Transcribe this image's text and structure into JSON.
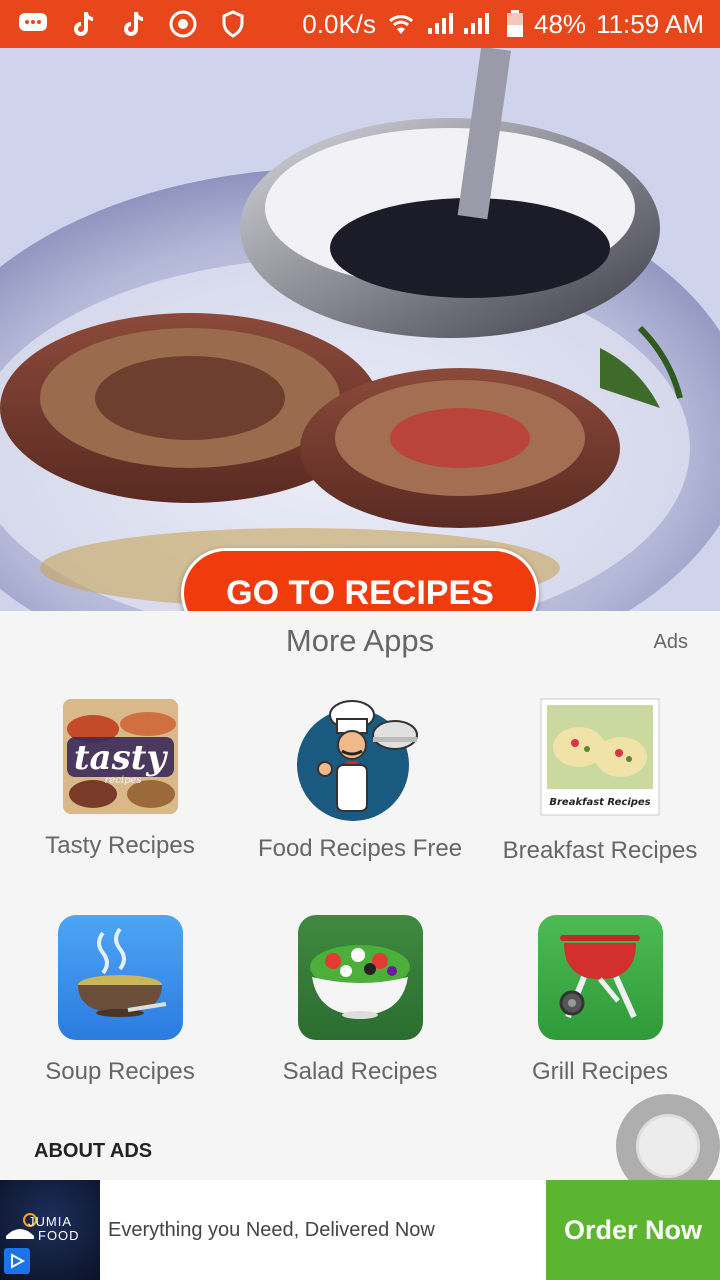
{
  "status_bar": {
    "network_speed": "0.0K/s",
    "battery": "48%",
    "time": "11:59 AM"
  },
  "hero": {
    "cta_label": "GO TO RECIPES"
  },
  "more_apps": {
    "title": "More Apps",
    "ads_label": "Ads",
    "apps": [
      {
        "label": "Tasty Recipes",
        "icon_text": "tasty",
        "icon_subtext": "recipes"
      },
      {
        "label": "Food Recipes Free"
      },
      {
        "label": "Breakfast Recipes",
        "icon_text": "Breakfast Recipes"
      },
      {
        "label": "Soup Recipes"
      },
      {
        "label": "Salad Recipes"
      },
      {
        "label": "Grill Recipes"
      }
    ],
    "about_ads": "ABOUT ADS"
  },
  "ad_banner": {
    "logo_line1": "JUMIA",
    "logo_line2": "FOOD",
    "text": "Everything you Need, Delivered Now",
    "cta": "Order Now"
  },
  "colors": {
    "status_bar": "#e8471c",
    "cta_button": "#f03c0c",
    "ad_cta": "#5cb531"
  }
}
